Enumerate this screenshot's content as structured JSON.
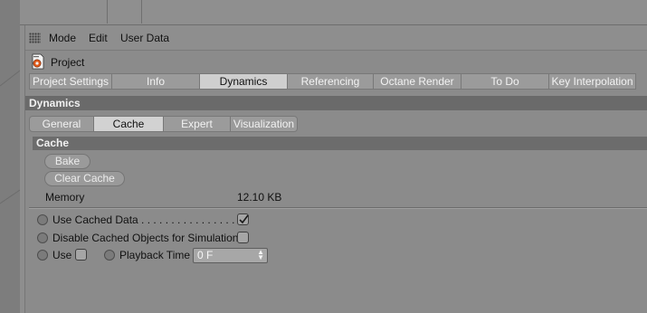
{
  "menubar": {
    "items": [
      "Mode",
      "Edit",
      "User Data"
    ]
  },
  "object": {
    "title": "Project",
    "icon": "project-icon"
  },
  "tabs": [
    {
      "label": "Project Settings",
      "active": false
    },
    {
      "label": "Info",
      "active": false
    },
    {
      "label": "Dynamics",
      "active": true
    },
    {
      "label": "Referencing",
      "active": false
    },
    {
      "label": "Octane Render",
      "active": false
    },
    {
      "label": "To Do",
      "active": false
    },
    {
      "label": "Key Interpolation",
      "active": false
    }
  ],
  "section": {
    "title": "Dynamics"
  },
  "subtabs": [
    {
      "label": "General",
      "active": false
    },
    {
      "label": "Cache",
      "active": true
    },
    {
      "label": "Expert",
      "active": false
    },
    {
      "label": "Visualization",
      "active": false
    }
  ],
  "cache": {
    "title": "Cache",
    "bake_label": "Bake",
    "clear_cache_label": "Clear Cache",
    "memory_label": "Memory",
    "memory_value": "12.10 KB",
    "use_cached_data_label": "Use Cached Data . . . . . . . . . . . . . . . . . .",
    "use_cached_data_checked": true,
    "disable_cached_label": "Disable Cached Objects for Simulation",
    "disable_cached_checked": false,
    "use_label": "Use",
    "use_checked": false,
    "playback_time_label": "Playback Time",
    "playback_time_value": "0 F"
  },
  "colors": {
    "panel_bg": "#8b8b8b",
    "header_bg": "#6a6a6a",
    "active_tab": "#cfcfcf"
  }
}
